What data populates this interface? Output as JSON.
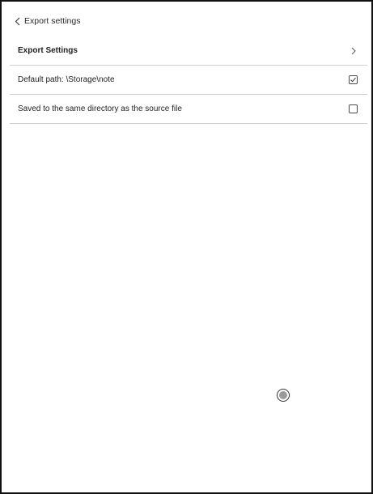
{
  "header": {
    "back_icon": "chevron-left-icon",
    "title": "Export settings"
  },
  "rows": [
    {
      "label": "Export Settings",
      "icon": "chevron-right-icon"
    },
    {
      "label": "Default path: \\Storage\\note",
      "checked": true
    },
    {
      "label": "Saved to the same directory as the source file",
      "checked": false
    }
  ],
  "floating_button": {
    "icon": "floating-ball-icon"
  },
  "colors": {
    "border": "#111111",
    "divider": "#cfcfcf",
    "text": "#1f1f1f",
    "ball_fill": "#9a9a9a"
  }
}
